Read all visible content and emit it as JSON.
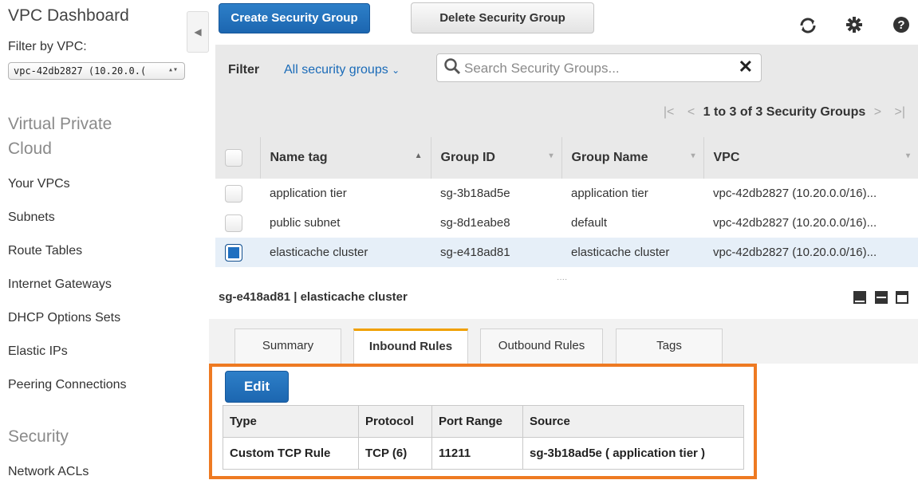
{
  "sidebar": {
    "title": "VPC Dashboard",
    "filter_label": "Filter by VPC:",
    "filter_value": "vpc-42db2827 (10.20.0.(",
    "section_vpc": "Virtual Private Cloud",
    "items": [
      "Your VPCs",
      "Subnets",
      "Route Tables",
      "Internet Gateways",
      "DHCP Options Sets",
      "Elastic IPs",
      "Peering Connections"
    ],
    "section_security": "Security",
    "security_items": [
      "Network ACLs"
    ]
  },
  "toolbar": {
    "create_label": "Create Security Group",
    "delete_label": "Delete Security Group",
    "icons": [
      "refresh-icon",
      "gear-icon",
      "help-icon"
    ]
  },
  "filter": {
    "label": "Filter",
    "dropdown": "All security groups",
    "search_placeholder": "Search Security Groups..."
  },
  "pager": {
    "text": "1 to 3 of 3 Security Groups"
  },
  "table": {
    "columns": [
      "Name tag",
      "Group ID",
      "Group Name",
      "VPC"
    ],
    "rows": [
      {
        "name_tag": "application tier",
        "group_id": "sg-3b18ad5e",
        "group_name": "application tier",
        "vpc": "vpc-42db2827 (10.20.0.0/16)...",
        "selected": false
      },
      {
        "name_tag": "public subnet",
        "group_id": "sg-8d1eabe8",
        "group_name": "default",
        "vpc": "vpc-42db2827 (10.20.0.0/16)...",
        "selected": false
      },
      {
        "name_tag": "elasticache cluster",
        "group_id": "sg-e418ad81",
        "group_name": "elasticache cluster",
        "vpc": "vpc-42db2827 (10.20.0.0/16)...",
        "selected": true
      }
    ]
  },
  "detail": {
    "title": "sg-e418ad81 | elasticache cluster",
    "tabs": [
      "Summary",
      "Inbound Rules",
      "Outbound Rules",
      "Tags"
    ],
    "active_tab": "Inbound Rules",
    "edit_label": "Edit",
    "rules_columns": [
      "Type",
      "Protocol",
      "Port Range",
      "Source"
    ],
    "rules": [
      {
        "type": "Custom TCP Rule",
        "protocol": "TCP (6)",
        "port_range": "11211",
        "source": "sg-3b18ad5e ( application tier )"
      }
    ]
  },
  "colors": {
    "accent": "#1c66b0",
    "highlight": "#ee7a22",
    "tab_active": "#f0a000"
  }
}
